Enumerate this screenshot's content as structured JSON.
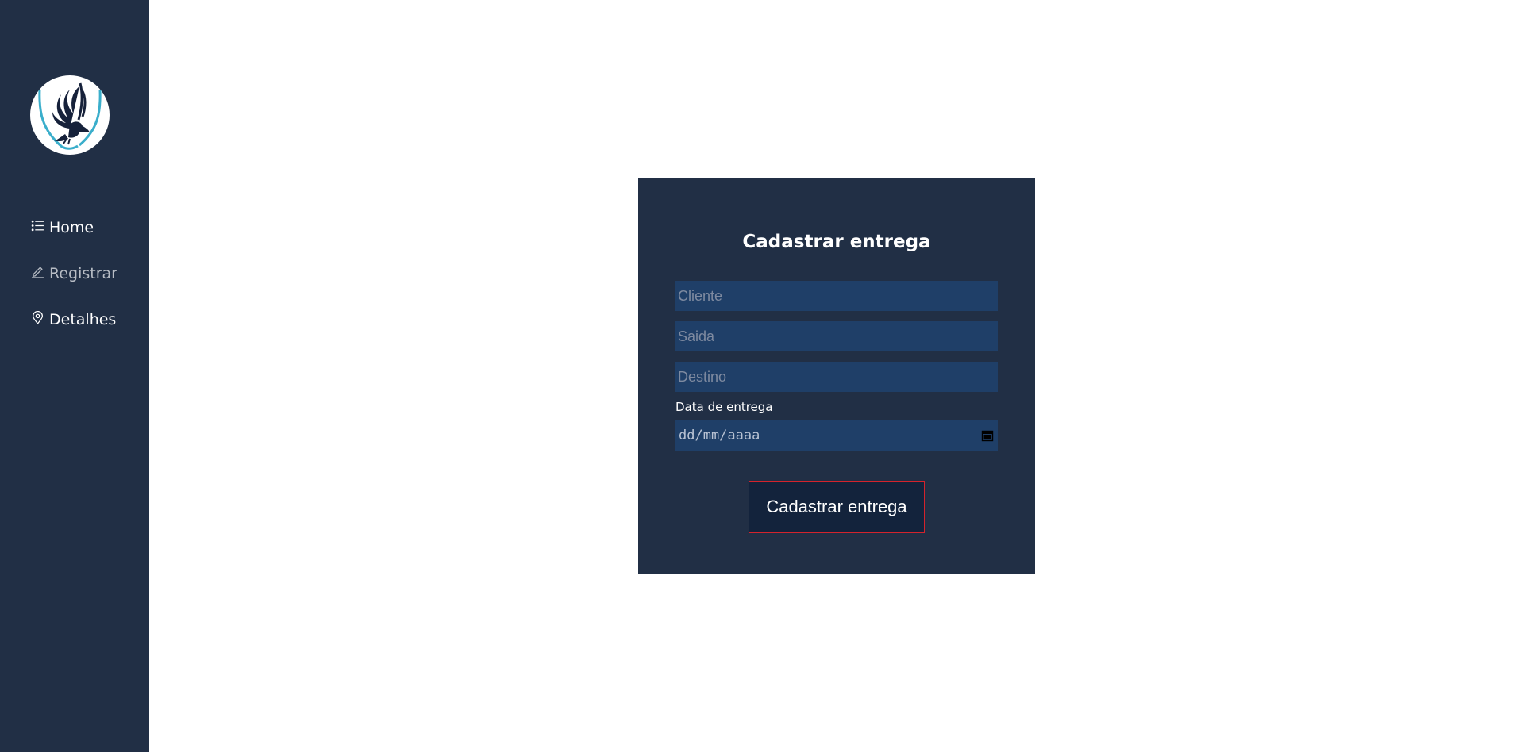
{
  "brand": {
    "logo_icon": "eagle-shield-logo"
  },
  "sidebar": {
    "items": [
      {
        "label": "Home",
        "icon": "list-icon"
      },
      {
        "label": "Registrar",
        "icon": "pencil-icon"
      },
      {
        "label": "Detalhes",
        "icon": "map-pin-icon"
      }
    ]
  },
  "form": {
    "title": "Cadastrar entrega",
    "cliente_placeholder": "Cliente",
    "cliente_value": "",
    "saida_placeholder": "Saida",
    "saida_value": "",
    "destino_placeholder": "Destino",
    "destino_value": "",
    "date_label": "Data de entrega",
    "date_placeholder": "dd/mm/aaaa",
    "submit_label": "Cadastrar entrega"
  },
  "colors": {
    "sidebar_bg": "#212f45",
    "card_bg": "#212f45",
    "input_bg": "#1f3f68",
    "button_bg": "#13233c",
    "button_border": "#d4232c",
    "logo_accent": "#3aaecb"
  }
}
